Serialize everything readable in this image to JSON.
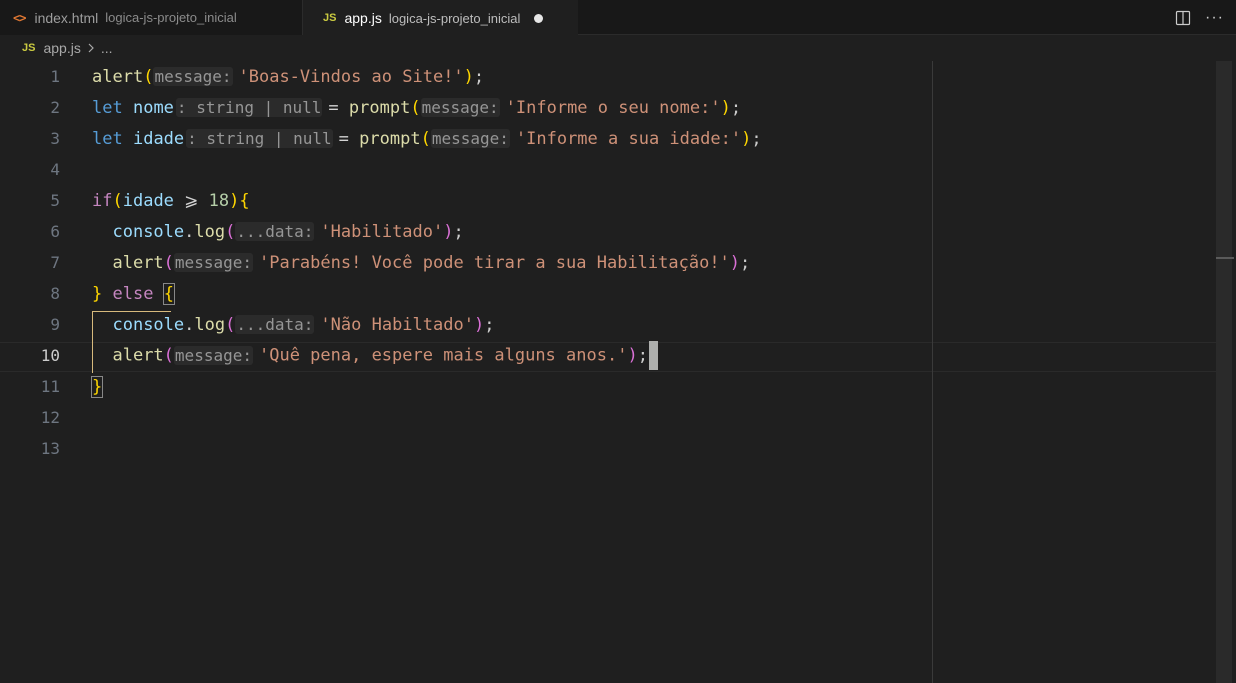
{
  "tabs": [
    {
      "icon": "<>",
      "label": "index.html",
      "desc": "logica-js-projeto_inicial"
    },
    {
      "icon": "JS",
      "label": "app.js",
      "desc": "logica-js-projeto_inicial"
    }
  ],
  "breadcrumb": {
    "icon": "JS",
    "file": "app.js",
    "rest": "..."
  },
  "line_numbers": [
    "1",
    "2",
    "3",
    "4",
    "5",
    "6",
    "7",
    "8",
    "9",
    "10",
    "11",
    "12",
    "13"
  ],
  "code": {
    "l1": {
      "fn": "alert",
      "hint": "message:",
      "str": "'Boas-Vindos ao Site!'"
    },
    "l2": {
      "kw": "let",
      "var": "nome",
      "hint": ": string | null",
      "fn": "prompt",
      "hint2": "message:",
      "str": "'Informe o seu nome:'"
    },
    "l3": {
      "kw": "let",
      "var": "idade",
      "hint": ": string | null",
      "fn": "prompt",
      "hint2": "message:",
      "str": "'Informe a sua idade:'"
    },
    "l5": {
      "kw": "if",
      "var": "idade",
      "op": "⩾",
      "num": "18"
    },
    "l6": {
      "obj": "console",
      "fn": "log",
      "hint": "...data:",
      "str": "'Habilitado'"
    },
    "l7": {
      "fn": "alert",
      "hint": "message:",
      "str": "'Parabéns! Você pode tirar a sua Habilitação!'"
    },
    "l8": {
      "kw": "else"
    },
    "l9": {
      "obj": "console",
      "fn": "log",
      "hint": "...data:",
      "str": "'Não Habiltado'"
    },
    "l10": {
      "fn": "alert",
      "hint": "message:",
      "str": "'Quê pena, espere mais alguns anos.'"
    }
  }
}
